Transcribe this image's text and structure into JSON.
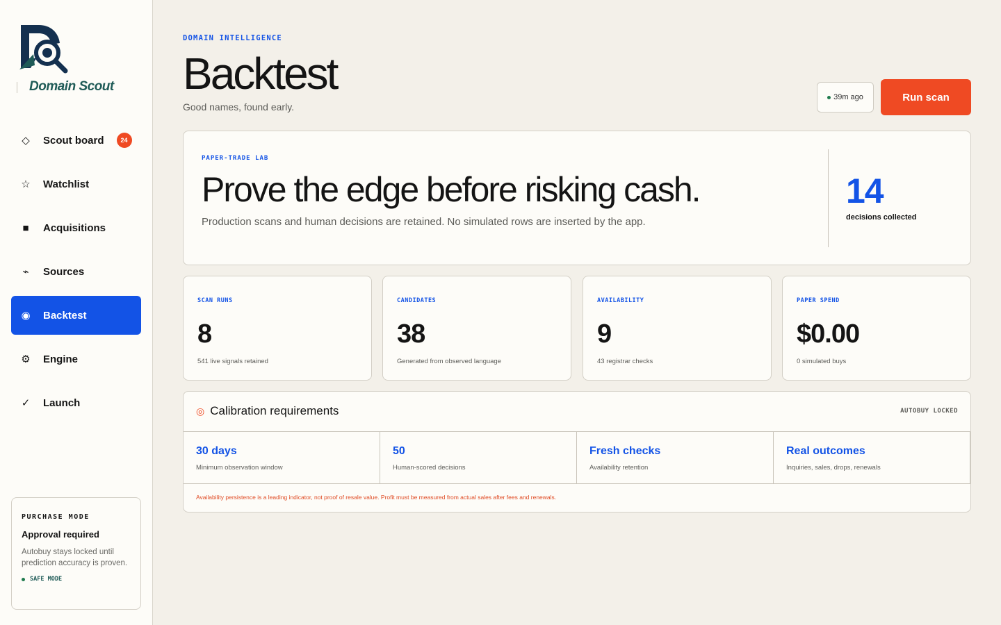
{
  "brand": {
    "name": "Domain Scout"
  },
  "nav": [
    {
      "label": "Scout board",
      "icon": "diamond-icon",
      "glyph": "◇",
      "badge": "24",
      "active": false
    },
    {
      "label": "Watchlist",
      "icon": "star-icon",
      "glyph": "☆",
      "badge": null,
      "active": false
    },
    {
      "label": "Acquisitions",
      "icon": "square-icon",
      "glyph": "■",
      "badge": null,
      "active": false
    },
    {
      "label": "Sources",
      "icon": "signal-icon",
      "glyph": "⌁",
      "badge": null,
      "active": false
    },
    {
      "label": "Backtest",
      "icon": "target-icon",
      "glyph": "◉",
      "badge": null,
      "active": true
    },
    {
      "label": "Engine",
      "icon": "gear-icon",
      "glyph": "⚙",
      "badge": null,
      "active": false
    },
    {
      "label": "Launch",
      "icon": "check-icon",
      "glyph": "✓",
      "badge": null,
      "active": false
    }
  ],
  "purchase": {
    "label": "PURCHASE MODE",
    "title": "Approval required",
    "description": "Autobuy stays locked until prediction accuracy is proven.",
    "status": "SAFE MODE"
  },
  "header": {
    "eyebrow": "DOMAIN INTELLIGENCE",
    "title": "Backtest",
    "subtitle": "Good names, found early.",
    "last_scan": "39m ago",
    "run_label": "Run scan"
  },
  "hero": {
    "eyebrow": "PAPER-TRADE LAB",
    "title": "Prove the edge before risking cash.",
    "description": "Production scans and human decisions are retained. No simulated rows are inserted by the app.",
    "metric_value": "14",
    "metric_label": "decisions collected"
  },
  "stats": [
    {
      "label": "SCAN RUNS",
      "value": "8",
      "caption": "541 live signals retained"
    },
    {
      "label": "CANDIDATES",
      "value": "38",
      "caption": "Generated from observed language"
    },
    {
      "label": "AVAILABILITY",
      "value": "9",
      "caption": "43 registrar checks"
    },
    {
      "label": "PAPER SPEND",
      "value": "$0.00",
      "caption": "0 simulated buys"
    }
  ],
  "calibration": {
    "title": "Calibration requirements",
    "lock_status": "AUTOBUY LOCKED",
    "requirements": [
      {
        "title": "30 days",
        "caption": "Minimum observation window"
      },
      {
        "title": "50",
        "caption": "Human-scored decisions"
      },
      {
        "title": "Fresh checks",
        "caption": "Availability retention"
      },
      {
        "title": "Real outcomes",
        "caption": "Inquiries, sales, drops, renewals"
      }
    ],
    "note": "Availability persistence is a leading indicator, not proof of resale value. Profit must be measured from actual sales after fees and renewals."
  },
  "colors": {
    "accent": "#1353e6",
    "cta": "#ef4a23",
    "brand": "#1f5b57",
    "background": "#f3f0e9"
  }
}
